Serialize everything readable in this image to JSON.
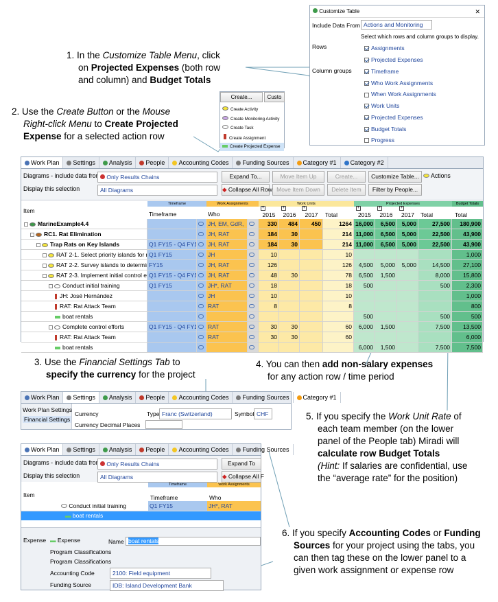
{
  "instructions": {
    "step1": {
      "n": "1.",
      "a": "In the ",
      "b": "Customize Table Menu",
      "c": ", click",
      "d": "on ",
      "e": "Projected Expenses",
      "f": " (both row",
      "g": "and column) and ",
      "h": "Budget Totals"
    },
    "step2": {
      "n": "2.",
      "a": "Use the ",
      "b": "Create Button",
      "c": " or the ",
      "d": "Mouse",
      "e": "Right-click Menu",
      "f": " to ",
      "g": "Create Projected",
      "h": "Expense",
      "i": " for a selected action row"
    },
    "step3": {
      "n": "3.",
      "a": "Use the ",
      "b": "Financial Settings Tab",
      "c": " to",
      "d": "specify the currency",
      "e": " for the project"
    },
    "step4": {
      "n": "4.",
      "a": "You can then ",
      "b": "add non-salary expenses",
      "c": "for any action row / time period"
    },
    "step5": {
      "n": "5.",
      "a": "If you specify the ",
      "b": "Work Unit Rate",
      "c": " of",
      "d": "each team member (on the lower",
      "e": "panel of the People tab) Miradi will",
      "f": "calculate row Budget Totals",
      "g": "(Hint:",
      "h": " If salaries are confidential, use",
      "i": "the “average rate” for the position)"
    },
    "step6": {
      "n": "6.",
      "a": "If you specify ",
      "b": "Accounting Codes",
      "c": " or ",
      "d": "Funding",
      "e": "Sources",
      "f": " for your project using the tabs, you",
      "g": "can then tag these on the lower panel to a",
      "h": "given work assignment or expense row"
    }
  },
  "customize": {
    "title": "Customize Table",
    "close": "✕",
    "include_label": "Include Data From",
    "include_value": "Actions and Monitoring",
    "hint": "Select which rows and column groups to display.",
    "rows_label": "Rows",
    "rows": [
      {
        "label": "Assignments",
        "checked": true
      },
      {
        "label": "Projected Expenses",
        "checked": true
      }
    ],
    "cols_label": "Column groups",
    "cols": [
      {
        "label": "Timeframe",
        "checked": true
      },
      {
        "label": "Who Work Assignments",
        "checked": true
      },
      {
        "label": "When Work Assignments",
        "checked": false
      },
      {
        "label": "Work Units",
        "checked": true
      },
      {
        "label": "Projected Expenses",
        "checked": true
      },
      {
        "label": "Budget Totals",
        "checked": true
      },
      {
        "label": "Progress",
        "checked": false
      }
    ]
  },
  "create_menu": {
    "button": "Create...",
    "button2": "Custo",
    "items": [
      "Create Activity",
      "Create Monitoring Activity",
      "Create Task",
      "Create Assignment",
      "Create Projected Expense"
    ]
  },
  "main": {
    "tabs": [
      "Work Plan",
      "Settings",
      "Analysis",
      "People",
      "Accounting Codes",
      "Funding Sources",
      "Category #1",
      "Category #2"
    ],
    "diagrams_label": "Diagrams - include data from",
    "diagrams_value": "Only Results Chains",
    "display_label": "Display this selection",
    "display_value": "All Diagrams",
    "expand": "Expand To...",
    "move_up": "Move Item Up",
    "create": "Create...",
    "customize": "Customize Table...",
    "actions": "Actions",
    "collapse": "Collapse All Rows",
    "move_down": "Move Item Down",
    "delete": "Delete Item",
    "filter": "Filter by People...",
    "group_headers": {
      "timeframe": "Timeframe",
      "work": "Work Assignments",
      "units": "Work Units",
      "proj": "Projected Expenses",
      "budget": "Budget Totals"
    },
    "col_item": "Item",
    "col_timeframe": "Timeframe",
    "col_who": "Who",
    "years": [
      "2015",
      "2016",
      "2017",
      "Total"
    ],
    "plus": "+",
    "rows": [
      {
        "item": "MarineExample4.4",
        "tf": "",
        "who": "JH, EM, GdR,",
        "u": [
          "330",
          "484",
          "450",
          "1264"
        ],
        "p": [
          "16,000",
          "6,500",
          "5,000",
          "27,500"
        ],
        "b": "180,900",
        "bold": true,
        "lvl": 0
      },
      {
        "item": "RC1. Rat Elimination",
        "tf": "",
        "who": "JH, RAT",
        "u": [
          "184",
          "30",
          "",
          "214"
        ],
        "p": [
          "11,000",
          "6,500",
          "5,000",
          "22,500"
        ],
        "b": "43,900",
        "bold": true,
        "lvl": 1
      },
      {
        "item": "Trap Rats on Key Islands",
        "tf": "Q1 FY15 - Q4 FY17",
        "who": "JH, RAT",
        "u": [
          "184",
          "30",
          "",
          "214"
        ],
        "p": [
          "11,000",
          "6,500",
          "5,000",
          "22,500"
        ],
        "b": "43,900",
        "bold": true,
        "lvl": 2
      },
      {
        "item": "RAT 2-1. Select priority islands for rat",
        "tf": "Q1 FY15",
        "who": "JH",
        "u": [
          "10",
          "",
          "",
          "10"
        ],
        "p": [
          "",
          "",
          "",
          ""
        ],
        "b": "1,000",
        "bold": false,
        "lvl": 3
      },
      {
        "item": "RAT 2-2. Survey islands to determine",
        "tf": "FY15",
        "who": "JH, RAT",
        "u": [
          "126",
          "",
          "",
          "126"
        ],
        "p": [
          "4,500",
          "5,000",
          "5,000",
          "14,500"
        ],
        "b": "27,100",
        "bold": false,
        "lvl": 3
      },
      {
        "item": "RAT 2-3. Implement initial control eff",
        "tf": "Q1 FY15 - Q4 FY17",
        "who": "JH, RAT",
        "u": [
          "48",
          "30",
          "",
          "78"
        ],
        "p": [
          "6,500",
          "1,500",
          "",
          "8,000"
        ],
        "b": "15,800",
        "bold": false,
        "lvl": 3
      },
      {
        "item": "Conduct initial training",
        "tf": "Q1 FY15",
        "who": "JH*, RAT",
        "u": [
          "18",
          "",
          "",
          "18"
        ],
        "p": [
          "500",
          "",
          "",
          "500"
        ],
        "b": "2,300",
        "bold": false,
        "lvl": 4
      },
      {
        "item": "JH: José Hernández",
        "tf": "",
        "who": "JH",
        "u": [
          "10",
          "",
          "",
          "10"
        ],
        "p": [
          "",
          "",
          "",
          ""
        ],
        "b": "1,000",
        "bold": false,
        "lvl": 5
      },
      {
        "item": "RAT: Rat Attack Team",
        "tf": "",
        "who": "RAT",
        "u": [
          "8",
          "",
          "",
          "8"
        ],
        "p": [
          "",
          "",
          "",
          ""
        ],
        "b": "800",
        "bold": false,
        "lvl": 5
      },
      {
        "item": "boat rentals",
        "tf": "",
        "who": "",
        "u": [
          "",
          "",
          "",
          ""
        ],
        "p": [
          "500",
          "",
          "",
          "500"
        ],
        "b": "500",
        "bold": false,
        "lvl": 5
      },
      {
        "item": "Complete control efforts",
        "tf": "Q1 FY15 - Q4 FY17",
        "who": "RAT",
        "u": [
          "30",
          "30",
          "",
          "60"
        ],
        "p": [
          "6,000",
          "1,500",
          "",
          "7,500"
        ],
        "b": "13,500",
        "bold": false,
        "lvl": 4
      },
      {
        "item": "RAT: Rat Attack Team",
        "tf": "",
        "who": "RAT",
        "u": [
          "30",
          "30",
          "",
          "60"
        ],
        "p": [
          "",
          "",
          "",
          ""
        ],
        "b": "6,000",
        "bold": false,
        "lvl": 5
      },
      {
        "item": "boat rentals",
        "tf": "",
        "who": "",
        "u": [
          "",
          "",
          "",
          ""
        ],
        "p": [
          "6,000",
          "1,500",
          "",
          "7,500"
        ],
        "b": "7,500",
        "bold": false,
        "lvl": 5
      }
    ]
  },
  "settings": {
    "tabs": [
      "Work Plan",
      "Settings",
      "Analysis",
      "People",
      "Accounting Codes",
      "Funding Sources",
      "Category #1"
    ],
    "side": [
      "Work Plan Settings",
      "Financial Settings"
    ],
    "currency_label": "Currency",
    "type_label": "Type",
    "type_value": "Franc (Switzerland)",
    "symbol_label": "Symbol",
    "symbol_value": "CHF",
    "decimal_label": "Currency Decimal Places"
  },
  "expense": {
    "tabs": [
      "Work Plan",
      "Settings",
      "Analysis",
      "People",
      "Accounting Codes",
      "Funding Sources"
    ],
    "diagrams_label": "Diagrams - include data from",
    "diagrams_value": "Only Results Chains",
    "display_label": "Display this selection",
    "display_value": "All Diagrams",
    "expand": "Expand To",
    "collapse": "Collapse All F",
    "group_tf": "Timeframe",
    "group_wa": "Work Assignments",
    "col_item": "Item",
    "col_tf": "Timeframe",
    "col_who": "Who",
    "row1_item": "Conduct initial training",
    "row1_tf": "Q1 FY15",
    "row1_who": "JH*, RAT",
    "row2_item": "boat rentals",
    "panel_tab": "Expense",
    "panel_type": "Expense",
    "name_label": "Name",
    "name_value": "boat rentals",
    "prog1": "Program Classifications",
    "prog2": "Program Classifications",
    "acc_label": "Accounting Code",
    "acc_value": "2100: Field equipment",
    "fund_label": "Funding Source",
    "fund_value": "IDB: Island Development Bank"
  },
  "colors": {
    "blue": "#a9c8ef",
    "orange": "#fbc34f",
    "yellow": "#fbe79b",
    "green": "#7fd1a6",
    "green2": "#62bf8c",
    "link": "#20469c"
  }
}
